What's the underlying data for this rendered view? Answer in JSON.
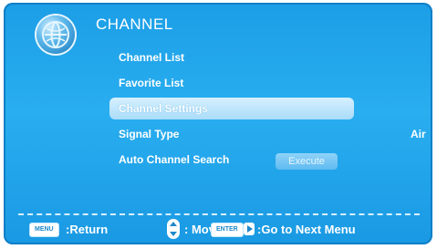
{
  "menu": {
    "title": "CHANNEL",
    "items": [
      {
        "label": "Channel List"
      },
      {
        "label": "Favorite List"
      },
      {
        "label": "Channel Settings",
        "selected": true
      },
      {
        "label": "Signal Type",
        "value": "Air"
      },
      {
        "label": "Auto Channel Search",
        "button": "Execute"
      }
    ]
  },
  "footer": {
    "menu_key": "MENU",
    "return_text": ":Return",
    "move_text": ": Move",
    "enter_key": "ENTER",
    "next_text": ":Go to Next Menu"
  },
  "colors": {
    "accent": "#29aef0",
    "selection": "#cbeafc"
  },
  "icons": {
    "header": "globe-icon",
    "move": "up-down-arrow-icon",
    "next": "right-arrow-icon"
  }
}
